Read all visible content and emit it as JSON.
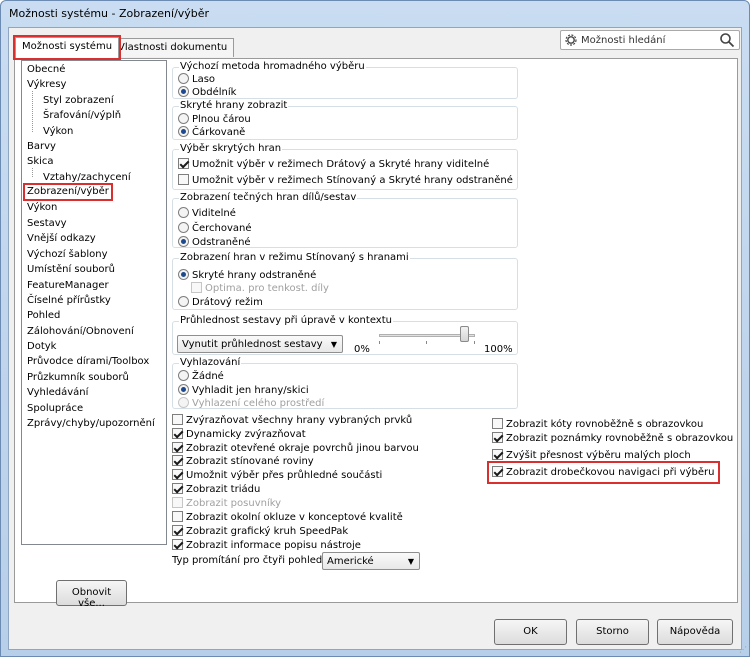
{
  "window": {
    "title": "Možnosti systému - Zobrazení/výběr"
  },
  "tabs": [
    {
      "label": "Možnosti systému"
    },
    {
      "label": "Vlastnosti dokumentu"
    }
  ],
  "search": {
    "placeholder": "Možnosti hledání"
  },
  "tree": [
    "Obecné",
    "Výkresy",
    "Styl zobrazení",
    "Šrafování/výplň",
    "Výkon",
    "Barvy",
    "Skica",
    "Vztahy/zachycení",
    "Zobrazení/výběr",
    "Výkon",
    "Sestavy",
    "Vnější odkazy",
    "Výchozí šablony",
    "Umístění souborů",
    "FeatureManager",
    "Číselné přírůstky",
    "Pohled",
    "Zálohování/Obnovení",
    "Dotyk",
    "Průvodce dírami/Toolbox",
    "Průzkumník souborů",
    "Vyhledávání",
    "Spolupráce",
    "Zprávy/chyby/upozornění"
  ],
  "groups": {
    "mass_select": {
      "title": "Výchozí metoda hromadného výběru",
      "options": [
        "Laso",
        "Obdélník"
      ]
    },
    "hidden_edges": {
      "title": "Skryté hrany zobrazit",
      "options": [
        "Plnou čárou",
        "Čárkovaně"
      ]
    },
    "hidden_select": {
      "title": "Výběr skrytých hran",
      "options": [
        "Umožnit výběr v režimech Drátový a Skryté hrany viditelné",
        "Umožnit výběr v režimech Stínovaný a Skryté hrany odstraněné"
      ]
    },
    "tangent_edges": {
      "title": "Zobrazení tečných hran dílů/sestav",
      "options": [
        "Viditelné",
        "Čerchované",
        "Odstraněné"
      ]
    },
    "shaded_edges": {
      "title": "Zobrazení hran v režimu Stínovaný s hranami",
      "options": [
        "Skryté hrany odstraněné",
        "Optima. pro tenkost. díly",
        "Drátový režim"
      ]
    },
    "transparency": {
      "title": "Průhlednost sestavy při úpravě v kontextu",
      "select": "Vynutit průhlednost sestavy",
      "min_label": "0%",
      "max_label": "100%",
      "value": 0.9
    },
    "smoothing": {
      "title": "Vyhlazování",
      "options": [
        "Žádné",
        "Vyhladit jen hrany/skici",
        "Vyhlazení celého prostředí"
      ]
    }
  },
  "checks_left": [
    "Zvýrazňovat všechny hrany vybraných prvků",
    "Dynamicky zvýrazňovat",
    "Zobrazit otevřené okraje povrchů jinou barvou",
    "Zobrazit stínované roviny",
    "Umožnit výběr přes průhledné součásti",
    "Zobrazit triádu",
    "Zobrazit posuvníky",
    "Zobrazit okolní okluze v konceptové kvalitě",
    "Zobrazit grafický kruh SpeedPak",
    "Zobrazit informace popisu nástroje"
  ],
  "checks_right": [
    "Zobrazit kóty rovnoběžně s obrazovkou",
    "Zobrazit poznámky rovnoběžně s obrazovkou",
    "Zvýšit přesnost výběru malých ploch",
    "Zobrazit drobečkovou navigaci při výběru"
  ],
  "projection": {
    "label": "Typ promítání pro čtyři pohledy:",
    "value": "Americké"
  },
  "buttons": {
    "reset": "Obnovit vše...",
    "ok": "OK",
    "cancel": "Storno",
    "help": "Nápověda"
  }
}
